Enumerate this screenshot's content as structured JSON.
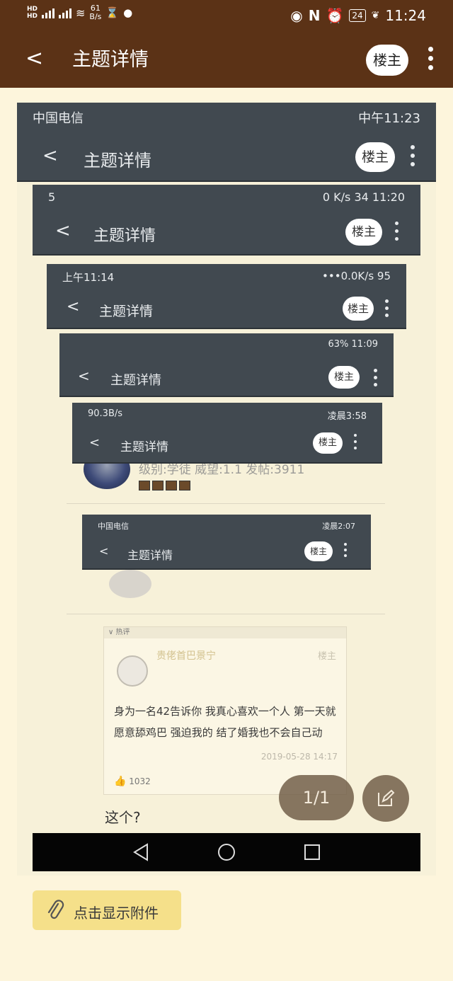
{
  "status_bar": {
    "net_speed_value": "61",
    "net_speed_unit": "B/s",
    "battery": "24",
    "time": "11:24"
  },
  "app_bar": {
    "title": "主题详情",
    "owner_button": "楼主"
  },
  "screenshot": {
    "stacked_headers": [
      {
        "status_left": "中国电信",
        "status_right": "中午11:23",
        "title": "主题详情",
        "pill": "楼主"
      },
      {
        "status_left": "5",
        "status_right": "0 K/s  34  11:20",
        "title": "主题详情",
        "pill": "楼主"
      },
      {
        "status_left": "上午11:14",
        "status_right": "•••0.0K/s  95",
        "title": "主题详情",
        "pill": "楼主"
      },
      {
        "status_left": "",
        "status_right": "63%  11:09",
        "title": "主题详情",
        "pill": "楼主"
      },
      {
        "status_left": "90.3B/s",
        "status_right": "凌晨3:58",
        "title": "主题详情",
        "pill": "楼主"
      },
      {
        "status_left": "中国电信",
        "status_right": "凌晨2:07",
        "title": "主题详情",
        "pill": "楼主"
      }
    ],
    "user_meta": "级别:学徒   威望:1.1   发帖:3911",
    "quoted_post": {
      "header": "∨ 热评",
      "username": "贵佬首巴景宁",
      "tag": "楼主",
      "body": "身为一名42告诉你 我真心喜欢一个人 第一天就愿意舔鸡巴 强迫我的 结了婚我也不会自己动",
      "date": "2019-05-28 14:17",
      "likes": "1032"
    },
    "post_text": "这个?",
    "page_indicator": "1/1"
  },
  "attachment_button": "点击显示附件",
  "colors": {
    "app_bar": "#5b3216",
    "page_bg": "#fdf5dc",
    "attach_bg": "#f5e08a",
    "stack_header": "#414950"
  }
}
